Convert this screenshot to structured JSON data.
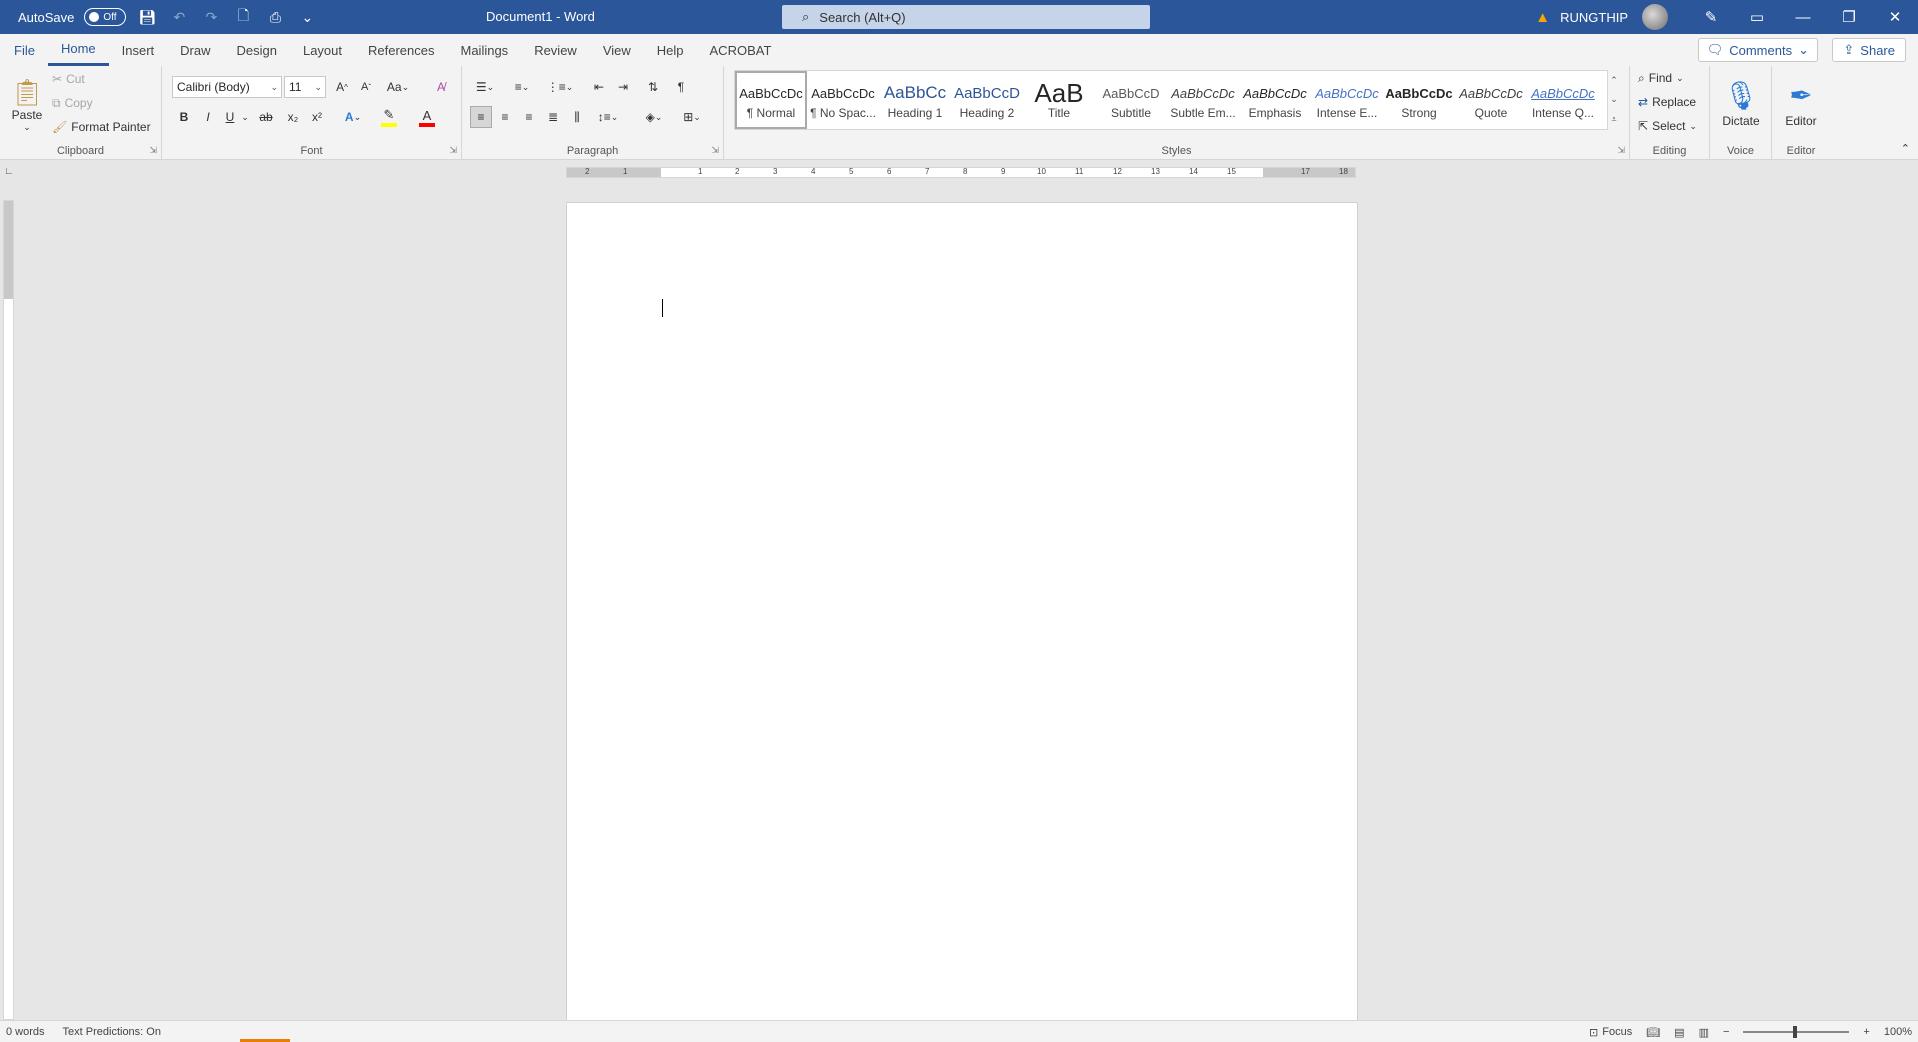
{
  "titlebar": {
    "autosave_label": "AutoSave",
    "autosave_state": "Off",
    "document_title": "Document1  -  Word",
    "search_placeholder": "Search (Alt+Q)",
    "user_name": "RUNGTHIP"
  },
  "tabs": [
    "File",
    "Home",
    "Insert",
    "Draw",
    "Design",
    "Layout",
    "References",
    "Mailings",
    "Review",
    "View",
    "Help",
    "ACROBAT"
  ],
  "active_tab": "Home",
  "actions": {
    "comments": "Comments",
    "share": "Share"
  },
  "clipboard": {
    "paste": "Paste",
    "cut": "Cut",
    "copy": "Copy",
    "format_painter": "Format Painter",
    "label": "Clipboard"
  },
  "font": {
    "family": "Calibri (Body)",
    "size": "11",
    "case_label": "Aa",
    "bold": "B",
    "italic": "I",
    "underline": "U",
    "strike": "ab",
    "subscript": "x₂",
    "superscript": "x²",
    "label": "Font",
    "highlight_color": "#ffff00",
    "font_color": "#ff0000"
  },
  "paragraph": {
    "label": "Paragraph",
    "show_marks": "¶"
  },
  "styles": {
    "label": "Styles",
    "items": [
      {
        "sample": "AaBbCcDc",
        "name": "¶ Normal"
      },
      {
        "sample": "AaBbCcDc",
        "name": "¶ No Spac..."
      },
      {
        "sample": "AaBbCc",
        "name": "Heading 1"
      },
      {
        "sample": "AaBbCcD",
        "name": "Heading 2"
      },
      {
        "sample": "AaB",
        "name": "Title"
      },
      {
        "sample": "AaBbCcD",
        "name": "Subtitle"
      },
      {
        "sample": "AaBbCcDc",
        "name": "Subtle Em..."
      },
      {
        "sample": "AaBbCcDc",
        "name": "Emphasis"
      },
      {
        "sample": "AaBbCcDc",
        "name": "Intense E..."
      },
      {
        "sample": "AaBbCcDc",
        "name": "Strong"
      },
      {
        "sample": "AaBbCcDc",
        "name": "Quote"
      },
      {
        "sample": "AaBbCcDc",
        "name": "Intense Q..."
      }
    ]
  },
  "editing": {
    "find": "Find",
    "replace": "Replace",
    "select": "Select",
    "label": "Editing"
  },
  "voice": {
    "dictate": "Dictate",
    "label": "Voice"
  },
  "editor_group": {
    "editor": "Editor",
    "label": "Editor"
  },
  "ruler": {
    "h_ticks": [
      "2",
      "1",
      "1",
      "2",
      "3",
      "4",
      "5",
      "6",
      "7",
      "8",
      "9",
      "10",
      "11",
      "12",
      "13",
      "14",
      "15",
      "16",
      "17",
      "18"
    ]
  },
  "status": {
    "words": "0 words",
    "predictions": "Text Predictions: On",
    "focus": "Focus",
    "zoom": "100%"
  },
  "colors": {
    "accent": "#2b579a",
    "warning": "#f7a600"
  }
}
